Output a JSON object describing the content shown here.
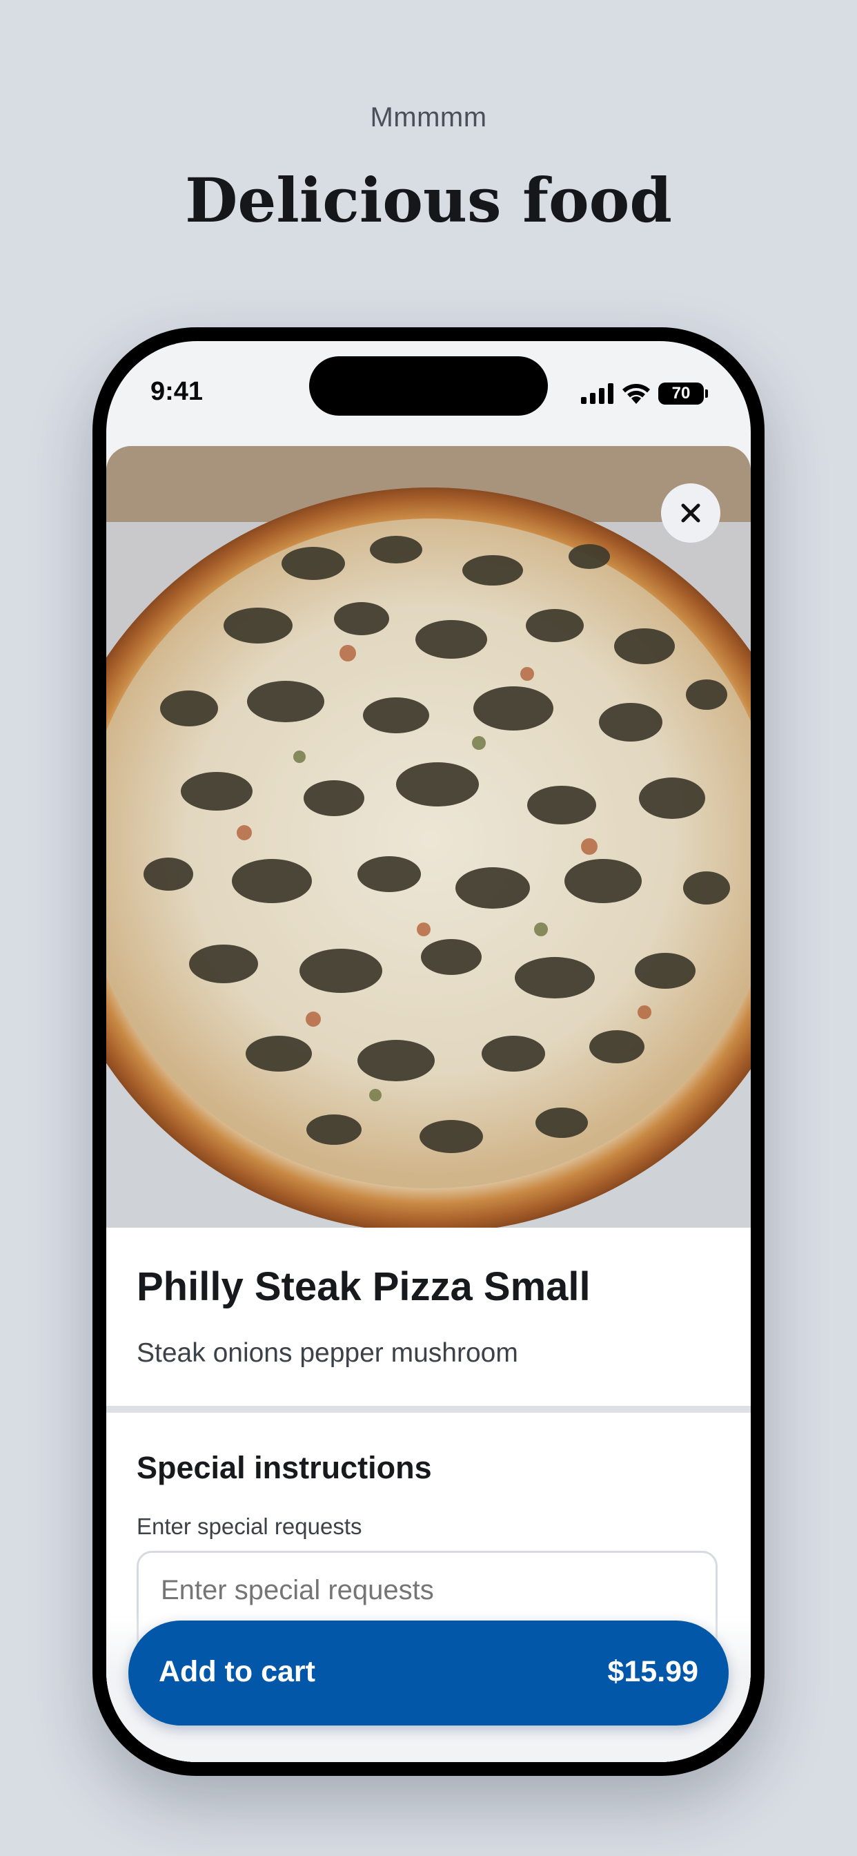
{
  "promo": {
    "eyebrow": "Mmmmm",
    "headline": "Delicious food"
  },
  "status_bar": {
    "time": "9:41",
    "battery": "70",
    "icons": [
      "signal-icon",
      "wifi-icon",
      "battery-icon"
    ]
  },
  "item": {
    "title": "Philly Steak Pizza Small",
    "description": "Steak onions pepper mushroom",
    "image_icon": "pizza-photo",
    "close_icon": "close-icon"
  },
  "instructions": {
    "title": "Special instructions",
    "subtitle": "Enter special requests",
    "placeholder": "Enter special requests"
  },
  "cart": {
    "label": "Add to cart",
    "price": "$15.99"
  },
  "colors": {
    "background": "#d8dce3",
    "primary": "#0357a8",
    "text": "#17191c"
  }
}
